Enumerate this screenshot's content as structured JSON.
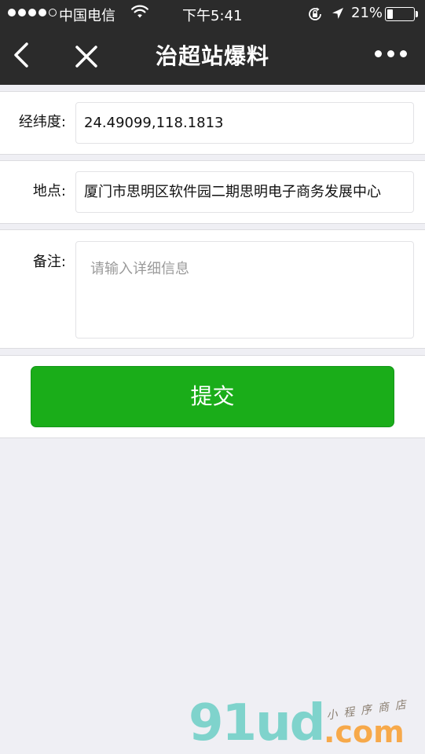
{
  "status_bar": {
    "carrier": "中国电信",
    "time": "下午5:41",
    "battery": "21%",
    "battery_level": 0.21,
    "icons": [
      "signal-dots-icon",
      "wifi-icon",
      "rotation-lock-icon",
      "location-arrow-icon",
      "battery-icon"
    ]
  },
  "nav": {
    "title": "治超站爆料",
    "back_icon": "chevron-left-icon",
    "close_icon": "close-icon",
    "more_icon": "more-dots-icon"
  },
  "form": {
    "coords_label": "经纬度:",
    "coords_value": "24.49099,118.1813",
    "location_label": "地点:",
    "location_value": "厦门市思明区软件园二期思明电子商务发展中心",
    "remark_label": "备注:",
    "remark_placeholder": "请输入详细信息",
    "submit_label": "提交"
  },
  "watermark": {
    "logo": "91ud",
    "domain": ".com",
    "tagline": "小程序商店"
  },
  "colors": {
    "nav_bg": "#2b2b2b",
    "page_bg": "#efeff4",
    "submit_green": "#1aad19"
  }
}
